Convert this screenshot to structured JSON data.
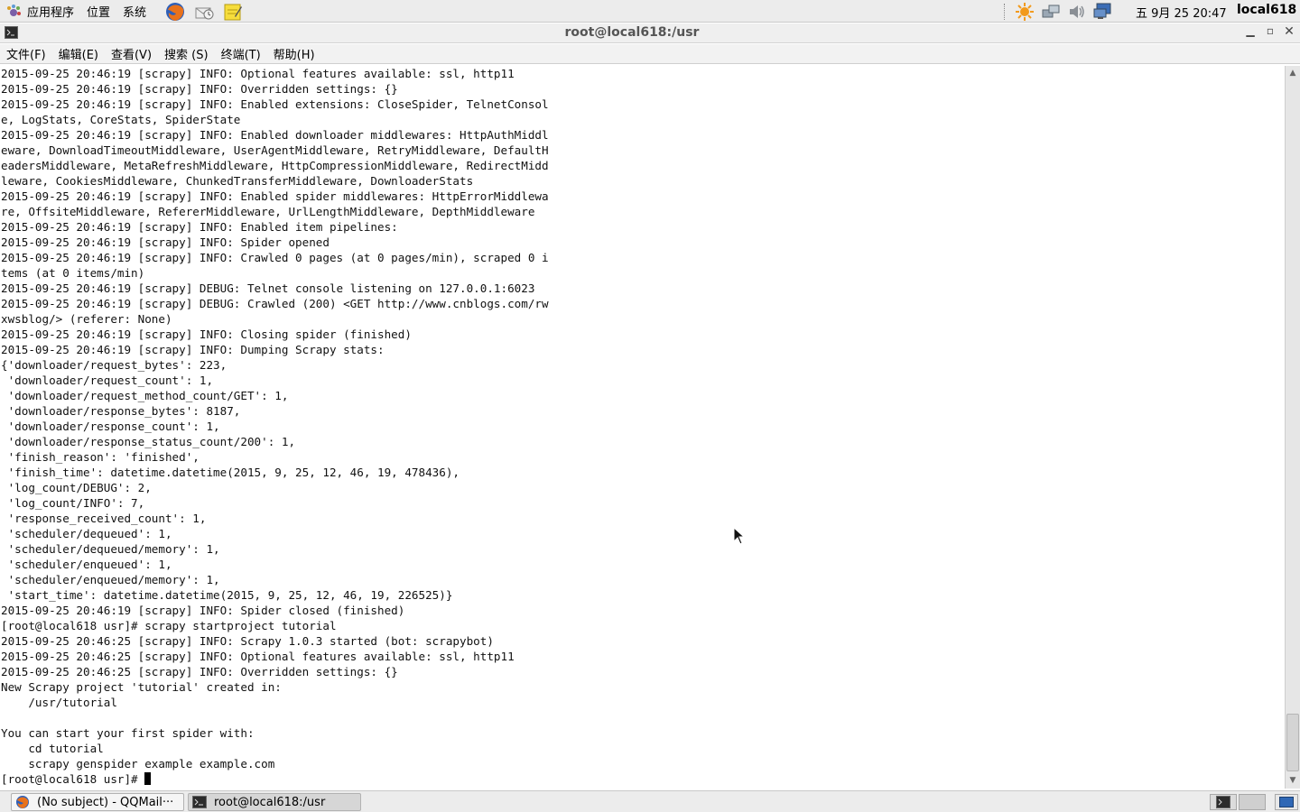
{
  "top_panel": {
    "menus": [
      "应用程序",
      "位置",
      "系统"
    ],
    "clock": "五 9月 25 20:47",
    "user": "local618",
    "launchers": [
      "firefox-icon",
      "mail-icon",
      "notes-icon"
    ],
    "tray_icons": [
      "update-sun-icon",
      "network-icon",
      "volume-icon",
      "display-icon"
    ]
  },
  "window": {
    "title": "root@local618:/usr",
    "controls": [
      "minimize",
      "maximize",
      "close"
    ]
  },
  "menubar": {
    "items": [
      "文件(F)",
      "编辑(E)",
      "查看(V)",
      "搜索 (S)",
      "终端(T)",
      "帮助(H)"
    ]
  },
  "terminal": {
    "lines": [
      "2015-09-25 20:46:19 [scrapy] INFO: Optional features available: ssl, http11",
      "2015-09-25 20:46:19 [scrapy] INFO: Overridden settings: {}",
      "2015-09-25 20:46:19 [scrapy] INFO: Enabled extensions: CloseSpider, TelnetConsol",
      "e, LogStats, CoreStats, SpiderState",
      "2015-09-25 20:46:19 [scrapy] INFO: Enabled downloader middlewares: HttpAuthMiddl",
      "eware, DownloadTimeoutMiddleware, UserAgentMiddleware, RetryMiddleware, DefaultH",
      "eadersMiddleware, MetaRefreshMiddleware, HttpCompressionMiddleware, RedirectMidd",
      "leware, CookiesMiddleware, ChunkedTransferMiddleware, DownloaderStats",
      "2015-09-25 20:46:19 [scrapy] INFO: Enabled spider middlewares: HttpErrorMiddlewa",
      "re, OffsiteMiddleware, RefererMiddleware, UrlLengthMiddleware, DepthMiddleware",
      "2015-09-25 20:46:19 [scrapy] INFO: Enabled item pipelines:",
      "2015-09-25 20:46:19 [scrapy] INFO: Spider opened",
      "2015-09-25 20:46:19 [scrapy] INFO: Crawled 0 pages (at 0 pages/min), scraped 0 i",
      "tems (at 0 items/min)",
      "2015-09-25 20:46:19 [scrapy] DEBUG: Telnet console listening on 127.0.0.1:6023",
      "2015-09-25 20:46:19 [scrapy] DEBUG: Crawled (200) <GET http://www.cnblogs.com/rw",
      "xwsblog/> (referer: None)",
      "2015-09-25 20:46:19 [scrapy] INFO: Closing spider (finished)",
      "2015-09-25 20:46:19 [scrapy] INFO: Dumping Scrapy stats:",
      "{'downloader/request_bytes': 223,",
      " 'downloader/request_count': 1,",
      " 'downloader/request_method_count/GET': 1,",
      " 'downloader/response_bytes': 8187,",
      " 'downloader/response_count': 1,",
      " 'downloader/response_status_count/200': 1,",
      " 'finish_reason': 'finished',",
      " 'finish_time': datetime.datetime(2015, 9, 25, 12, 46, 19, 478436),",
      " 'log_count/DEBUG': 2,",
      " 'log_count/INFO': 7,",
      " 'response_received_count': 1,",
      " 'scheduler/dequeued': 1,",
      " 'scheduler/dequeued/memory': 1,",
      " 'scheduler/enqueued': 1,",
      " 'scheduler/enqueued/memory': 1,",
      " 'start_time': datetime.datetime(2015, 9, 25, 12, 46, 19, 226525)}",
      "2015-09-25 20:46:19 [scrapy] INFO: Spider closed (finished)",
      "[root@local618 usr]# scrapy startproject tutorial",
      "2015-09-25 20:46:25 [scrapy] INFO: Scrapy 1.0.3 started (bot: scrapybot)",
      "2015-09-25 20:46:25 [scrapy] INFO: Optional features available: ssl, http11",
      "2015-09-25 20:46:25 [scrapy] INFO: Overridden settings: {}",
      "New Scrapy project 'tutorial' created in:",
      "    /usr/tutorial",
      "",
      "You can start your first spider with:",
      "    cd tutorial",
      "    scrapy genspider example example.com"
    ],
    "prompt": "[root@local618 usr]# "
  },
  "taskbar": {
    "tasks": [
      {
        "label": "(No subject) - QQMail···",
        "icon": "firefox-icon",
        "active": false
      },
      {
        "label": "root@local618:/usr",
        "icon": "terminal-icon",
        "active": true
      }
    ],
    "workspaces": [
      "terminal-icon",
      "workspace-2",
      "workspace-3"
    ]
  }
}
